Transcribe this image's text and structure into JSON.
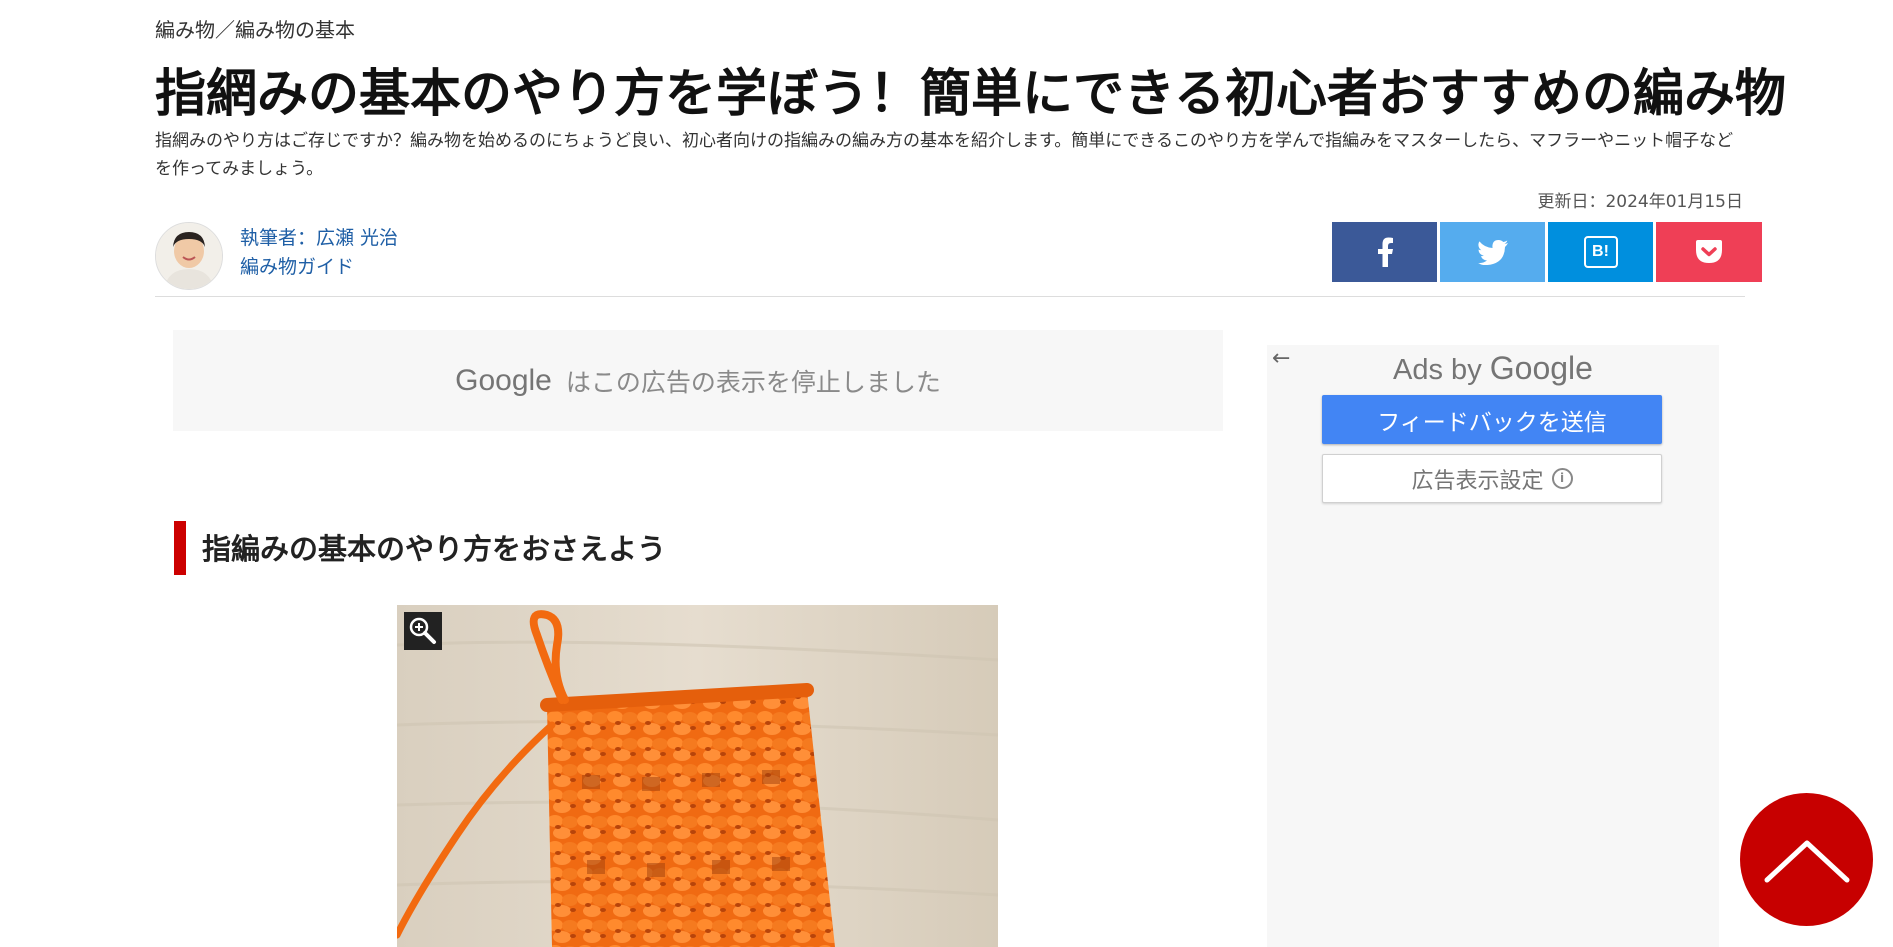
{
  "breadcrumb": "編み物／編み物の基本",
  "article": {
    "title": "指網みの基本のやり方を学ぼう！簡単にできる初心者おすすめの編み物",
    "lead": "指網みのやり方はご存じですか？編み物を始めるのにちょうど良い、初心者向けの指編みの編み方の基本を紹介します。簡単にできるこのやり方を学んで指編みをマスターしたら、マフラーやニット帽子などを作ってみましょう。",
    "updated": "更新日：2024年01月15日"
  },
  "author": {
    "line1": "執筆者：広瀬 光治",
    "line2": "編み物ガイド"
  },
  "share": {
    "facebook_icon": "facebook-icon",
    "twitter_icon": "twitter-icon",
    "hatena_label": "B!",
    "pocket_icon": "pocket-icon",
    "colors": {
      "facebook": "#3b5998",
      "twitter": "#55acee",
      "hatena": "#008fde",
      "pocket": "#ef3f56"
    }
  },
  "ad_notice": {
    "brand": "Google",
    "text": "はこの広告の表示を停止しました"
  },
  "section": {
    "heading": "指編みの基本のやり方をおさえよう",
    "accent": "#cc0000"
  },
  "sidebar_ad": {
    "ads_by": "Ads by",
    "brand": "Google",
    "feedback_button": "フィードバックを送信",
    "settings_button": "広告表示設定",
    "info_glyph": "i"
  },
  "back_to_top": {
    "icon": "chevron-up-icon",
    "color": "#c70000"
  }
}
